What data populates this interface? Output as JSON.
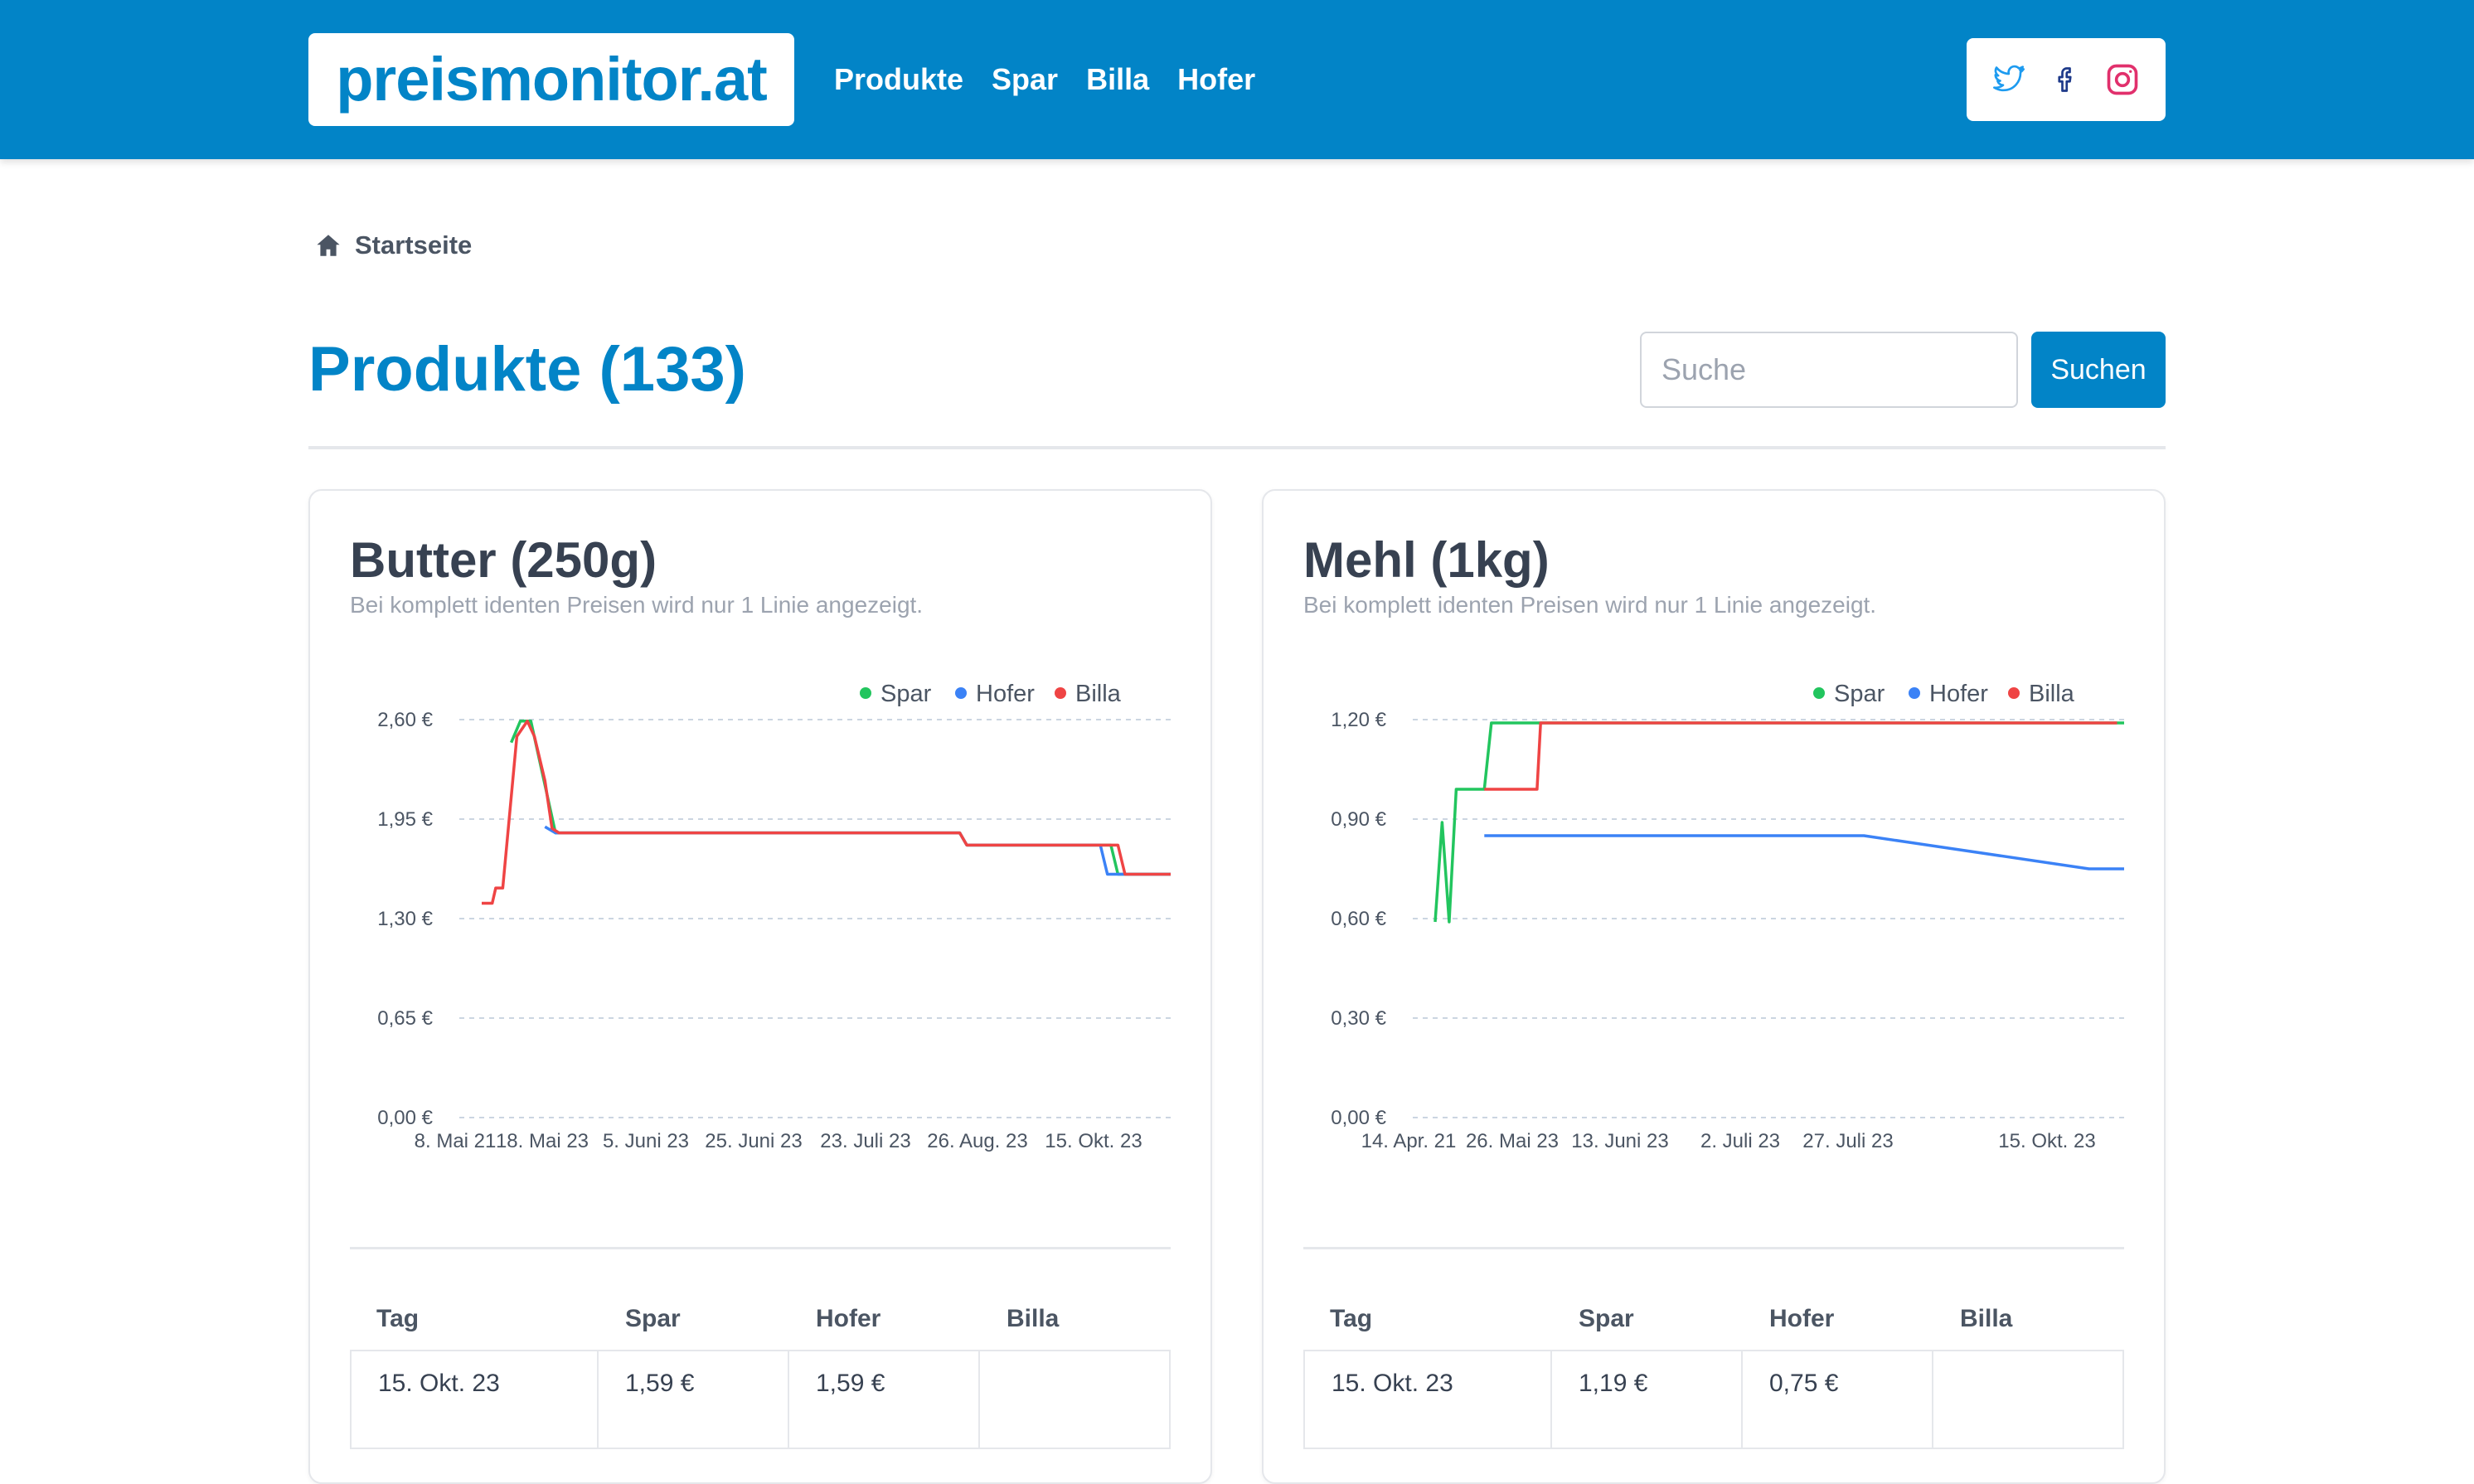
{
  "header": {
    "logo": "preismonitor.at",
    "nav": [
      "Produkte",
      "Spar",
      "Billa",
      "Hofer"
    ],
    "social": [
      "twitter-icon",
      "facebook-icon",
      "instagram-icon"
    ]
  },
  "breadcrumb": {
    "label": "Startseite",
    "icon": "home-icon"
  },
  "page": {
    "title": "Produkte (133)"
  },
  "search": {
    "placeholder": "Suche",
    "button": "Suchen"
  },
  "colors": {
    "brand": "#0284c7",
    "spar": "#22c55e",
    "hofer": "#3b82f6",
    "billa": "#ef4444"
  },
  "products": [
    {
      "title": "Butter (250g)",
      "subtitle": "Bei komplett identen Preisen wird nur 1 Linie angezeigt.",
      "table": {
        "headers": [
          "Tag",
          "Spar",
          "Hofer",
          "Billa"
        ],
        "rows": [
          [
            "15. Okt. 23",
            "1,59 €",
            "1,59 €",
            ""
          ]
        ]
      }
    },
    {
      "title": "Mehl (1kg)",
      "subtitle": "Bei komplett identen Preisen wird nur 1 Linie angezeigt.",
      "table": {
        "headers": [
          "Tag",
          "Spar",
          "Hofer",
          "Billa"
        ],
        "rows": [
          [
            "15. Okt. 23",
            "1,19 €",
            "0,75 €",
            ""
          ]
        ]
      }
    }
  ],
  "chart_data": [
    {
      "type": "line",
      "title": "Butter (250g)",
      "legend": [
        "Spar",
        "Hofer",
        "Billa"
      ],
      "legend_position": "top-right",
      "grid": true,
      "x_ticks": [
        "8. Mai 21",
        "18. Mai 23",
        "5. Juni 23",
        "25. Juni 23",
        "23. Juli 23",
        "26. Aug. 23",
        "15. Okt. 23"
      ],
      "y_ticks": [
        "0,00 €",
        "0,65 €",
        "1,30 €",
        "1,95 €",
        "2,60 €"
      ],
      "ylim": [
        0,
        2.6
      ],
      "series": [
        {
          "name": "Spar",
          "color": "#22c55e",
          "points": [
            [
              0.062,
              2.45
            ],
            [
              0.075,
              2.59
            ],
            [
              0.09,
              2.59
            ],
            [
              0.125,
              1.86
            ],
            [
              0.7,
              1.86
            ],
            [
              0.71,
              1.78
            ],
            [
              0.915,
              1.78
            ],
            [
              0.925,
              1.59
            ],
            [
              1.0,
              1.59
            ]
          ]
        },
        {
          "name": "Hofer",
          "color": "#3b82f6",
          "points": [
            [
              0.11,
              1.9
            ],
            [
              0.125,
              1.86
            ],
            [
              0.7,
              1.86
            ],
            [
              0.71,
              1.78
            ],
            [
              0.9,
              1.78
            ],
            [
              0.91,
              1.59
            ],
            [
              1.0,
              1.59
            ]
          ]
        },
        {
          "name": "Billa",
          "color": "#ef4444",
          "points": [
            [
              0.02,
              1.4
            ],
            [
              0.035,
              1.4
            ],
            [
              0.04,
              1.5
            ],
            [
              0.05,
              1.5
            ],
            [
              0.07,
              2.49
            ],
            [
              0.085,
              2.59
            ],
            [
              0.095,
              2.49
            ],
            [
              0.11,
              2.2
            ],
            [
              0.12,
              1.89
            ],
            [
              0.13,
              1.86
            ],
            [
              0.7,
              1.86
            ],
            [
              0.71,
              1.78
            ],
            [
              0.925,
              1.78
            ],
            [
              0.935,
              1.59
            ],
            [
              1.0,
              1.59
            ]
          ]
        }
      ]
    },
    {
      "type": "line",
      "title": "Mehl (1kg)",
      "legend": [
        "Spar",
        "Hofer",
        "Billa"
      ],
      "legend_position": "top-right",
      "grid": true,
      "x_ticks": [
        "14. Apr. 21",
        "26. Mai 23",
        "13. Juni 23",
        "2. Juli 23",
        "27. Juli 23",
        "15. Okt. 23"
      ],
      "y_ticks": [
        "0,00 €",
        "0,30 €",
        "0,60 €",
        "0,90 €",
        "1,20 €"
      ],
      "ylim": [
        0,
        1.2
      ],
      "series": [
        {
          "name": "Spar",
          "color": "#22c55e",
          "points": [
            [
              0.02,
              0.59
            ],
            [
              0.03,
              0.89
            ],
            [
              0.04,
              0.59
            ],
            [
              0.05,
              0.99
            ],
            [
              0.09,
              0.99
            ],
            [
              0.1,
              1.19
            ],
            [
              1.0,
              1.19
            ]
          ]
        },
        {
          "name": "Hofer",
          "color": "#3b82f6",
          "points": [
            [
              0.09,
              0.85
            ],
            [
              0.63,
              0.85
            ],
            [
              0.95,
              0.75
            ],
            [
              1.0,
              0.75
            ]
          ]
        },
        {
          "name": "Billa",
          "color": "#ef4444",
          "points": [
            [
              0.09,
              0.99
            ],
            [
              0.165,
              0.99
            ],
            [
              0.17,
              1.19
            ],
            [
              0.99,
              1.19
            ]
          ]
        }
      ]
    }
  ]
}
